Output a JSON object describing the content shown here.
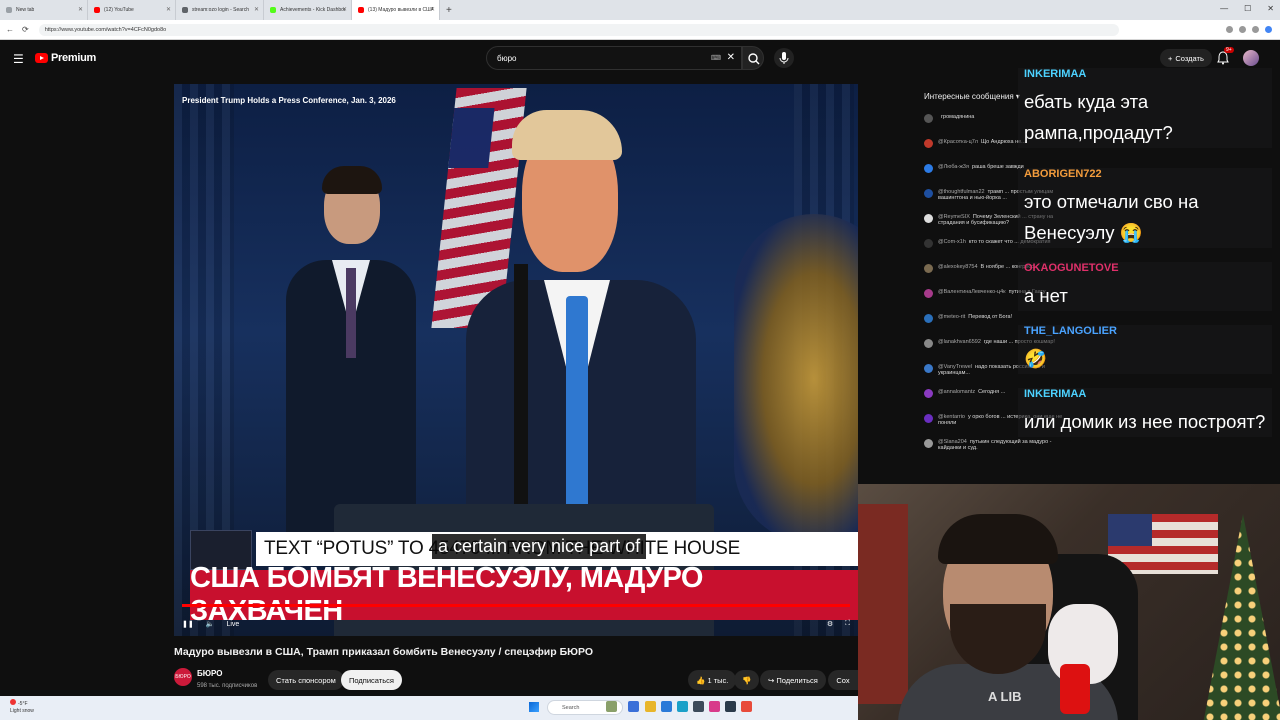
{
  "browser": {
    "tabs": [
      {
        "label": "New tab",
        "color": "#9aa0a6"
      },
      {
        "label": "(12) YouTube",
        "color": "#ff0000"
      },
      {
        "label": "stream:ozo login - Search",
        "color": "#5f6368"
      },
      {
        "label": "Achievements - Kick Dashboard",
        "color": "#53fc18"
      },
      {
        "label": "(13) Мадуро вывезли в США...",
        "color": "#ff0000"
      }
    ],
    "url": "https://www.youtube.com/watch?v=4CFcN0gdo8o"
  },
  "youtube": {
    "logo_text": "Premium",
    "search_value": "бюро",
    "create_label": "Создать",
    "notification_count": "9+"
  },
  "video": {
    "overlay_title": "President Trump Holds a Press Conference, Jan. 3, 2026",
    "lower_third_text": "TEXT “POTUS” TO 45470 ... FROM THE WHITE HOUSE",
    "headline": "США БОМБЯТ ВЕНЕСУЭЛУ, МАДУРО ЗАХВАЧЕН",
    "caption": "a certain very nice part of",
    "live_label": "Live",
    "progress": 1.0
  },
  "below_video": {
    "title": "Мадуро вывезли в США, Трамп приказал бомбить Венесуэлу / спецэфир БЮРО",
    "channel": "БЮРО",
    "subscribers": "598 тыс. подписчиков",
    "sponsor_label": "Стать спонсором",
    "subscribe_label": "Подписаться",
    "likes": "1 тыс.",
    "share_label": "Поделиться",
    "save_label": "Сох"
  },
  "chat": {
    "header": "Интересные сообщения",
    "messages": [
      {
        "user": "",
        "text": "громадянина",
        "color": "#555"
      },
      {
        "user": "@Красотка-ц7л",
        "text": "Що Андрюха не...",
        "color": "#c0392b"
      },
      {
        "user": "@Люба-ж3я",
        "text": "раша бреше завжди",
        "color": "#2c7be5"
      },
      {
        "user": "@thoughtfulman22",
        "text": "трамп ... простым улицам вашингтона и нью-йорка ...",
        "color": "#1e4fa0"
      },
      {
        "user": "@ReymeSIX",
        "text": "Почему Зеленский ... страну на страдания и бусификацию?",
        "color": "#ddd"
      },
      {
        "user": "@Com-x1h",
        "text": "кто то скажет что ... демократия",
        "color": "#333"
      },
      {
        "user": "@alexokey8754",
        "text": "В ноябре ... конгресс",
        "color": "#7a6a50"
      },
      {
        "user": "@ВалентинаЛевченко-ц4к",
        "text": "путина в Гаагу",
        "color": "#a63a8a"
      },
      {
        "user": "@meteo-rit",
        "text": "Перевод от Бога!",
        "color": "#2a6fba"
      },
      {
        "user": "@lanakhvan6592",
        "text": "где наши ... просто кошмар!",
        "color": "#888"
      },
      {
        "user": "@VanyTrewel",
        "text": "надо показать россиянам и украинцам...",
        "color": "#3a78c8"
      },
      {
        "user": "@annalomantz",
        "text": "Сегодня ...",
        "color": "#8a3ac0"
      },
      {
        "user": "@kentarrio",
        "text": "у орко богов ... истерика. они еще не поняли",
        "color": "#6a2ec0"
      },
      {
        "user": "@Slana204",
        "text": "путькин следующий за мадуро - кайданки и суд.",
        "color": "#999"
      }
    ]
  },
  "overlay": {
    "items": [
      {
        "user": "INKERIMAA",
        "text": "ебать куда эта рампа,продадут?",
        "color": "#4dd2ff"
      },
      {
        "user": "ABORIGEN722",
        "text": "это отмечали сво на Венесуэлу 😭",
        "color": "#f39c3c"
      },
      {
        "user": "OKAOGUNETOVE",
        "text": "а нет",
        "color": "#e0306a"
      },
      {
        "user": "THE_LANGOLIER",
        "text": "🤣",
        "color": "#4aa3ff"
      },
      {
        "user": "INKERIMAA",
        "text": "или домик из нее построят?",
        "color": "#4dd2ff"
      }
    ]
  },
  "webcam": {
    "shirt_text": "A LIB"
  },
  "taskbar": {
    "weather_temp": "-5°F",
    "weather_desc": "Light snow",
    "search_placeholder": "Search"
  }
}
